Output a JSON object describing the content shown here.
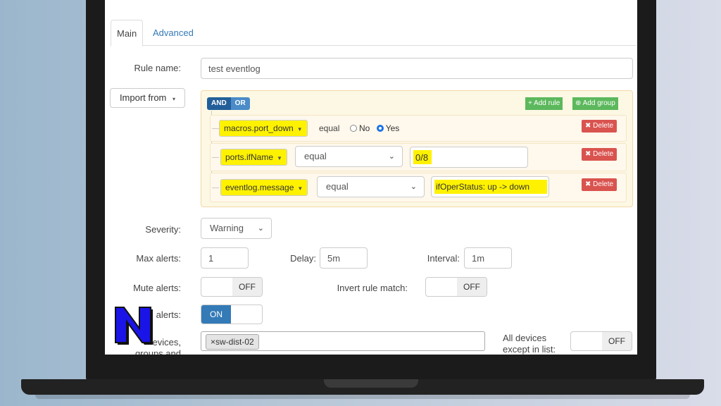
{
  "tabs": {
    "main": "Main",
    "advanced": "Advanced"
  },
  "rule_name": {
    "label": "Rule name:",
    "value": "test eventlog"
  },
  "import_from": {
    "label": "Import from",
    "caret": "▾"
  },
  "builder": {
    "and": "AND",
    "or": "OR",
    "add_rule": "+ Add rule",
    "add_group": "Add group",
    "delete_label": "Delete",
    "rules": [
      {
        "field": "macros.port_down",
        "operator": "equal",
        "radio_no": "No",
        "radio_yes": "Yes",
        "selected": "Yes"
      },
      {
        "field": "ports.ifName",
        "operator": "equal",
        "value": "0/8"
      },
      {
        "field": "eventlog.message",
        "operator": "equal",
        "value": "ifOperStatus: up -> down"
      }
    ]
  },
  "severity": {
    "label": "Severity:",
    "value": "Warning"
  },
  "max_alerts": {
    "label": "Max alerts:",
    "value": "1"
  },
  "delay": {
    "label": "Delay:",
    "value": "5m"
  },
  "interval": {
    "label": "Interval:",
    "value": "1m"
  },
  "mute_alerts": {
    "label": "Mute alerts:",
    "state": "OFF"
  },
  "invert_rule": {
    "label": "Invert rule match:",
    "state": "OFF"
  },
  "recovery_alerts": {
    "label": "alerts:",
    "state": "ON"
  },
  "devices": {
    "label_line1": "evices,",
    "label_line2": "groups and",
    "chip": "sw-dist-02",
    "chip_remove": "×"
  },
  "all_devices": {
    "label_line1": "All devices",
    "label_line2": "except in list:",
    "state": "OFF"
  },
  "colors": {
    "highlight": "#fff200",
    "link": "#337ab7",
    "success": "#5cb85c",
    "danger": "#d9534f",
    "logo": "#1a14e8"
  }
}
